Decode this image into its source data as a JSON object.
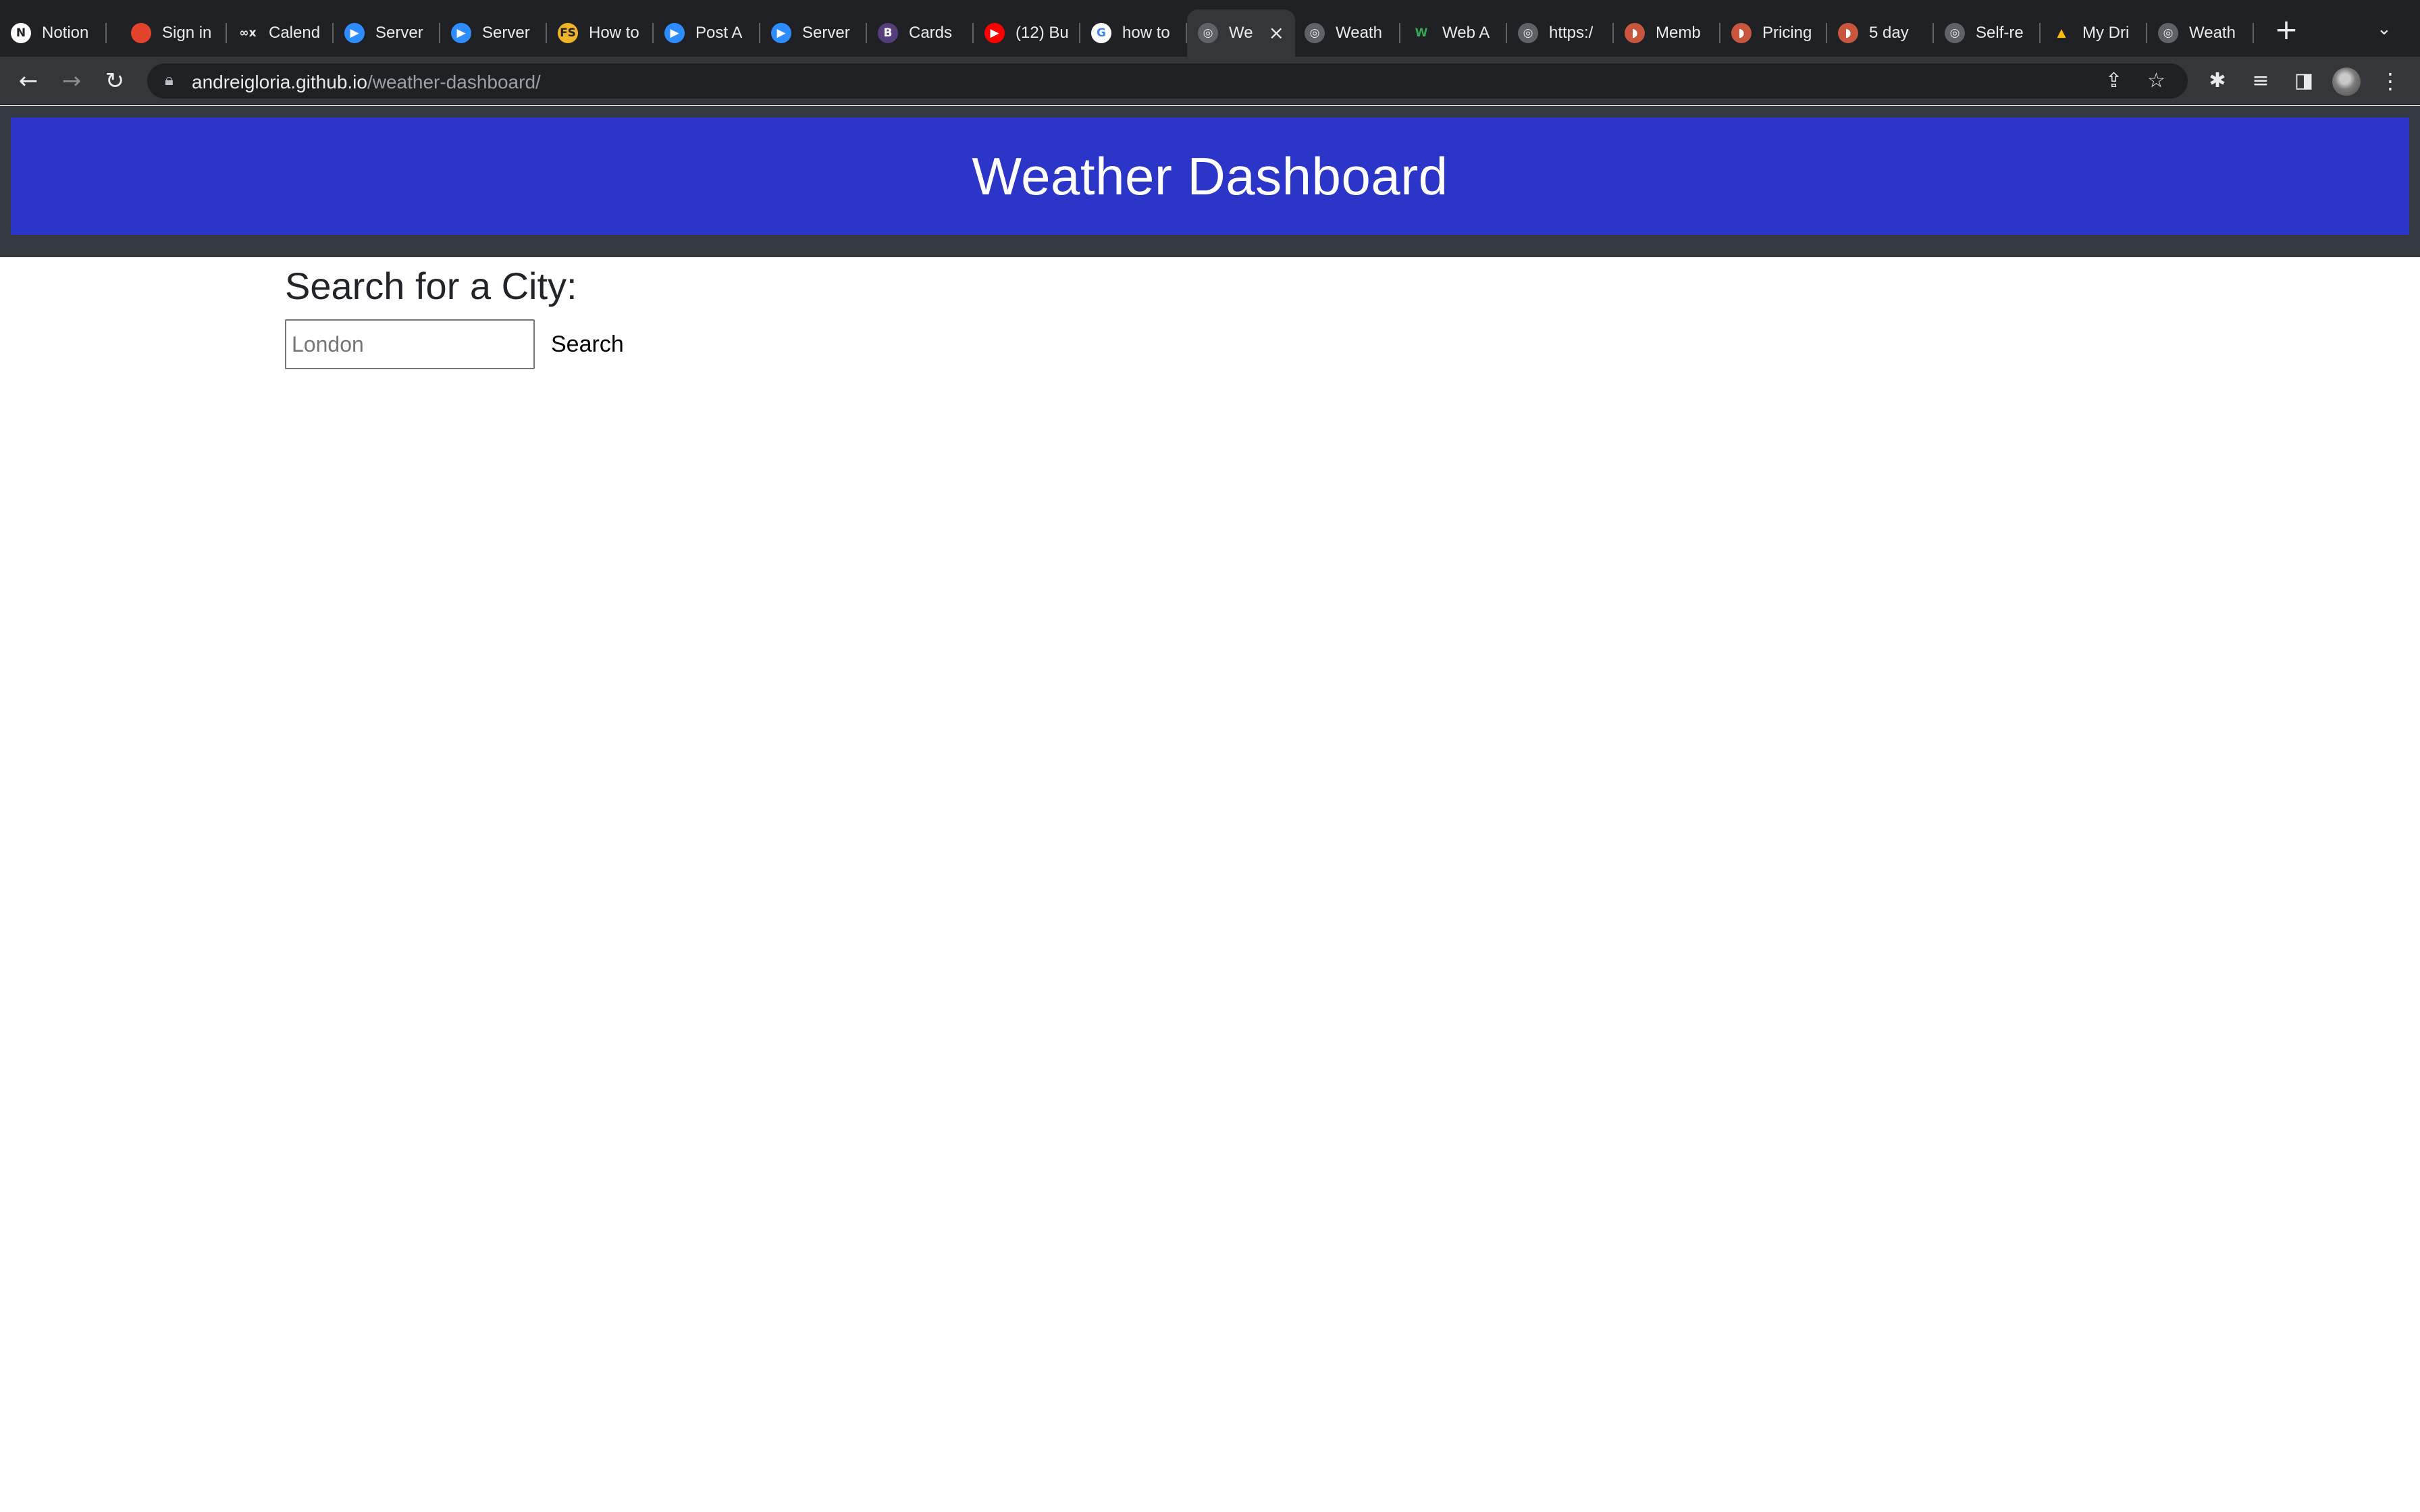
{
  "browser": {
    "tabs": [
      {
        "label": "Notion",
        "icon": "notion-icon",
        "glyph": "N",
        "color": "#ffffff",
        "fg": "#202124"
      },
      {
        "label": "Sign in",
        "icon": "gitlab-icon",
        "glyph": "",
        "color": "#e2432a",
        "fg": "#ffffff"
      },
      {
        "label": "Calend",
        "icon": "calendly-icon",
        "glyph": "∞x",
        "color": "#202124",
        "fg": "#e8eaed"
      },
      {
        "label": "Server",
        "icon": "zoom-icon",
        "glyph": "▶",
        "color": "#2d8cff",
        "fg": "#ffffff"
      },
      {
        "label": "Server",
        "icon": "zoom-icon",
        "glyph": "▶",
        "color": "#2d8cff",
        "fg": "#ffffff"
      },
      {
        "label": "How to",
        "icon": "fs-icon",
        "glyph": "FS",
        "color": "#f0b429",
        "fg": "#202124"
      },
      {
        "label": "Post A",
        "icon": "zoom-icon",
        "glyph": "▶",
        "color": "#2d8cff",
        "fg": "#ffffff"
      },
      {
        "label": "Server",
        "icon": "zoom-icon",
        "glyph": "▶",
        "color": "#2d8cff",
        "fg": "#ffffff"
      },
      {
        "label": "Cards",
        "icon": "bootstrap-icon",
        "glyph": "B",
        "color": "#563d7c",
        "fg": "#ffffff"
      },
      {
        "label": "(12) Bu",
        "icon": "youtube-icon",
        "glyph": "▶",
        "color": "#ff0000",
        "fg": "#ffffff"
      },
      {
        "label": "how to",
        "icon": "google-icon",
        "glyph": "G",
        "color": "#ffffff",
        "fg": "#4285f4"
      },
      {
        "label": "We",
        "icon": "globe-icon",
        "glyph": "◎",
        "color": "#5f6368",
        "fg": "#e8eaed",
        "active": true
      },
      {
        "label": "Weath",
        "icon": "globe-icon",
        "glyph": "◎",
        "color": "#5f6368",
        "fg": "#e8eaed"
      },
      {
        "label": "Web A",
        "icon": "w-icon",
        "glyph": "W",
        "color": "#202124",
        "fg": "#34a853"
      },
      {
        "label": "https:/",
        "icon": "globe-icon",
        "glyph": "◎",
        "color": "#5f6368",
        "fg": "#e8eaed"
      },
      {
        "label": "Memb",
        "icon": "helmet-icon",
        "glyph": "◗",
        "color": "#c8553d",
        "fg": "#ffffff"
      },
      {
        "label": "Pricing",
        "icon": "helmet-icon",
        "glyph": "◗",
        "color": "#c8553d",
        "fg": "#ffffff"
      },
      {
        "label": "5 day",
        "icon": "helmet-icon",
        "glyph": "◗",
        "color": "#c8553d",
        "fg": "#ffffff"
      },
      {
        "label": "Self-re",
        "icon": "globe-icon",
        "glyph": "◎",
        "color": "#5f6368",
        "fg": "#e8eaed"
      },
      {
        "label": "My Dri",
        "icon": "google-drive-icon",
        "glyph": "▲",
        "color": "#202124",
        "fg": "#fbbc04"
      },
      {
        "label": "Weath",
        "icon": "globe-icon",
        "glyph": "◎",
        "color": "#5f6368",
        "fg": "#e8eaed"
      }
    ],
    "url_host": "andreigloria.github.io",
    "url_path": "/weather-dashboard/"
  },
  "page": {
    "title": "Weather Dashboard",
    "search_heading": "Search for a City:",
    "search_placeholder": "London",
    "search_value": "",
    "search_button": "Search"
  },
  "colors": {
    "header_bg": "#2b35c7",
    "header_frame": "#343a40"
  }
}
